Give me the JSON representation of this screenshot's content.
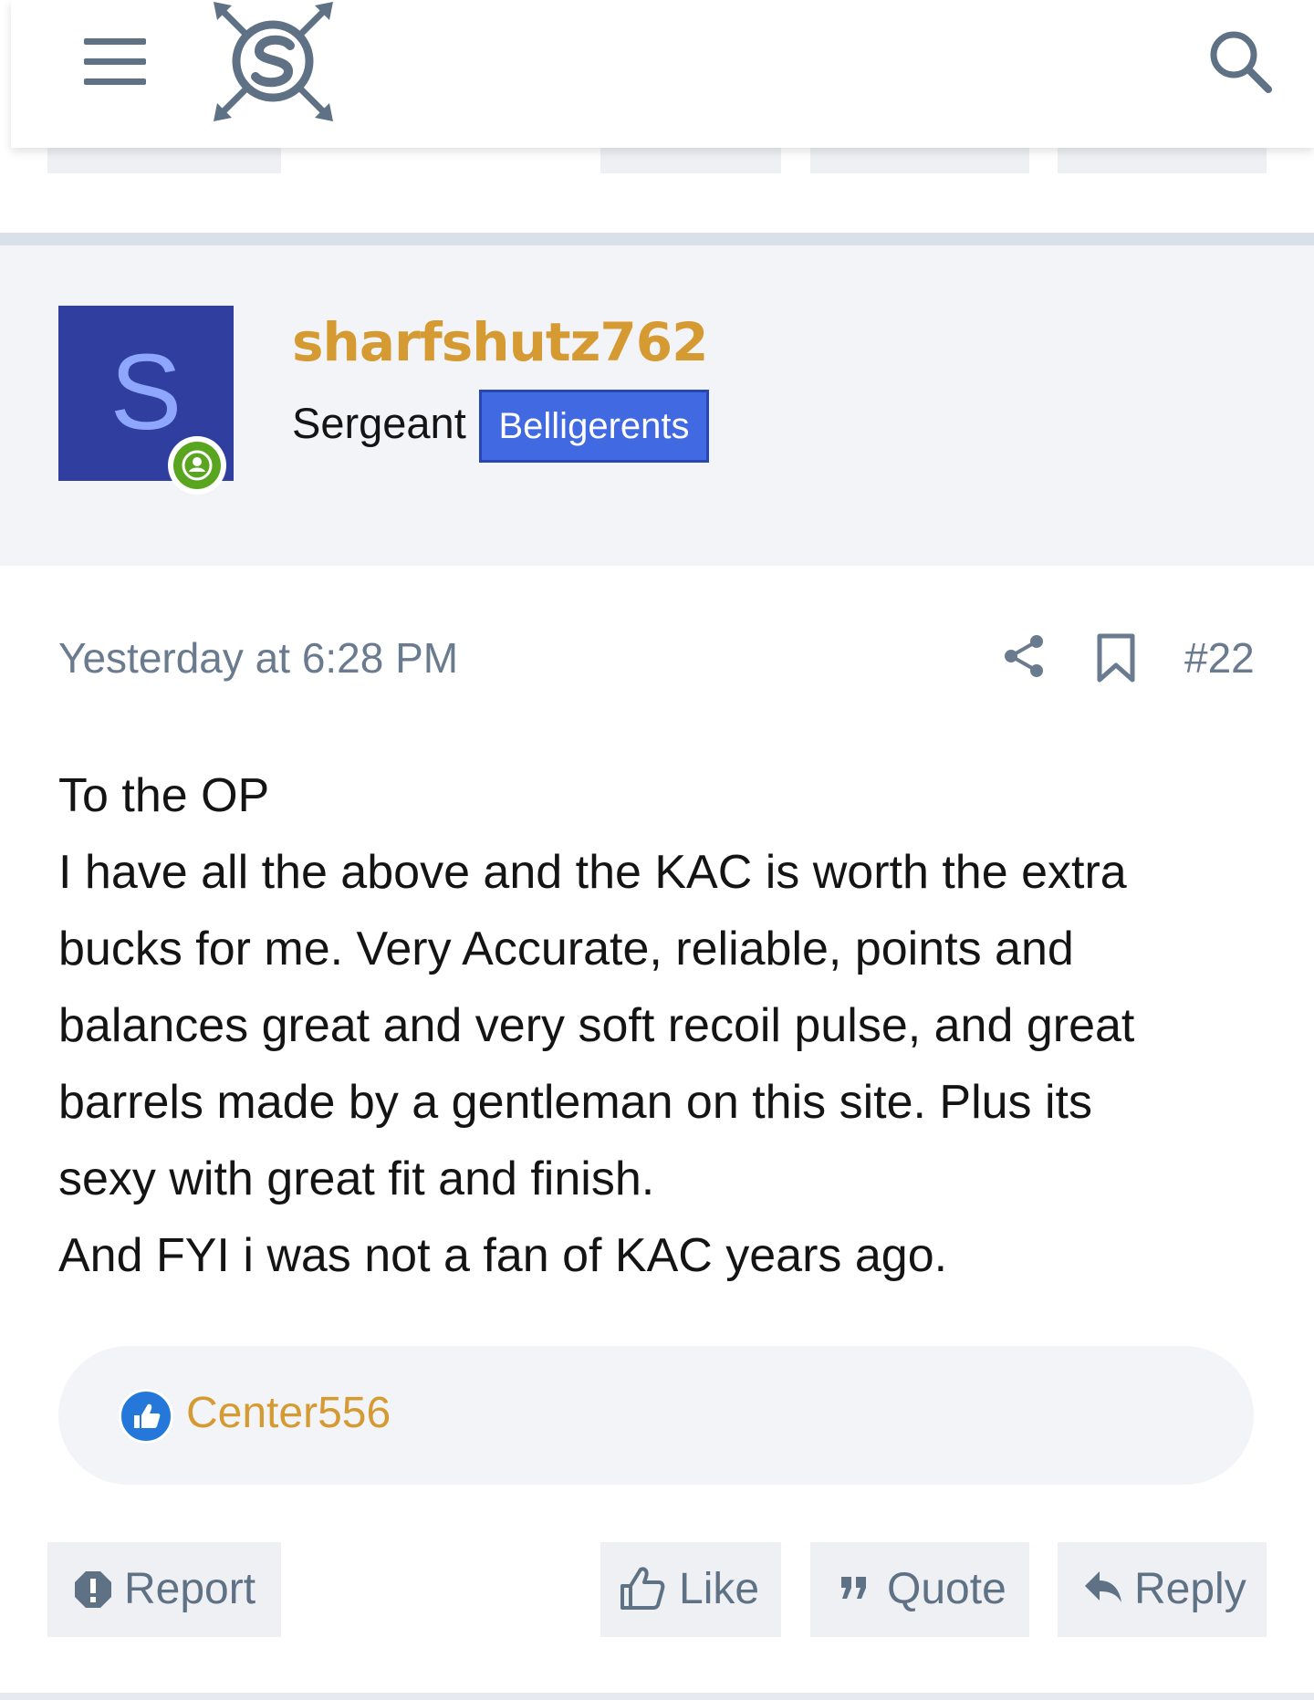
{
  "header": {
    "menu_icon": "hamburger-menu-icon",
    "logo_icon": "site-logo",
    "search_icon": "search-icon"
  },
  "post": {
    "author": {
      "avatar_letter": "S",
      "username": "sharfshutz762",
      "user_title": "Sergeant",
      "banner": "Belligerents",
      "online_status_icon": "online-user-icon"
    },
    "timestamp": "Yesterday at 6:28 PM",
    "post_number": "#22",
    "share_icon": "share-icon",
    "bookmark_icon": "bookmark-icon",
    "body_lines": [
      "To the OP",
      "I have all the above and the KAC is worth the extra",
      "bucks for me. Very Accurate, reliable, points and",
      "balances great and very soft recoil pulse, and great",
      "barrels made by a gentleman on this site. Plus its",
      "sexy with great fit and finish.",
      "And FYI i was not a fan of KAC years ago."
    ],
    "reactions": {
      "icon": "like-reaction-icon",
      "users": "Center556"
    },
    "actions": {
      "report": "Report",
      "like": "Like",
      "quote": "Quote",
      "reply": "Reply"
    }
  },
  "colors": {
    "username": "#d69a32",
    "avatar_bg": "#2f3e9f",
    "banner_bg": "#4169e1",
    "muted_text": "#6a7b8f",
    "online": "#5aa51f"
  }
}
